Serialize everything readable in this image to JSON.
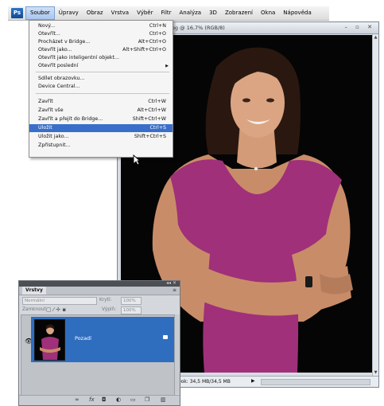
{
  "menubar": {
    "logo": "Ps",
    "items": [
      "Soubor",
      "Úpravy",
      "Obraz",
      "Vrstva",
      "Výběr",
      "Filtr",
      "Analýza",
      "3D",
      "Zobrazení",
      "Okna",
      "Nápověda"
    ],
    "active": "Soubor"
  },
  "file_menu": {
    "items": [
      {
        "label": "Nový...",
        "shortcut": "Ctrl+N"
      },
      {
        "label": "Otevřít...",
        "shortcut": "Ctrl+O"
      },
      {
        "label": "Procházet v Bridge...",
        "shortcut": "Alt+Ctrl+O"
      },
      {
        "label": "Otevřít jako...",
        "shortcut": "Alt+Shift+Ctrl+O"
      },
      {
        "label": "Otevřít jako inteligentní objekt...",
        "shortcut": ""
      },
      {
        "label": "Otevřít poslední",
        "shortcut": "",
        "submenu": true
      },
      {
        "label": "Sdílet obrazovku...",
        "shortcut": ""
      },
      {
        "label": "Device Central...",
        "shortcut": ""
      },
      {
        "label": "Zavřít",
        "shortcut": "Ctrl+W"
      },
      {
        "label": "Zavřít vše",
        "shortcut": "Alt+Ctrl+W"
      },
      {
        "label": "Zavřít a přejít do Bridge...",
        "shortcut": "Shift+Ctrl+W"
      },
      {
        "label": "Uložit",
        "shortcut": "Ctrl+S",
        "highlighted": true
      },
      {
        "label": "Uložit jako...",
        "shortcut": "Shift+Ctrl+S"
      },
      {
        "label": "Zpřístupnit...",
        "shortcut": ""
      }
    ]
  },
  "document": {
    "title": "jpg @ 16,7% (RGB/8)",
    "window_buttons": "– ▫ ✕",
    "status": "Dok: 34,5 MB/34,5 MB",
    "status_arrow": "▶"
  },
  "layers_panel": {
    "tab": "Vrstvy",
    "blend_mode": "Normální",
    "opacity_label": "Krytí:",
    "opacity_value": "100%",
    "lock_label": "Zamknout:",
    "fill_label": "Výplň:",
    "fill_value": "100%",
    "layer_name": "Pozadí",
    "bottom_icons": [
      "link-icon",
      "fx-icon",
      "mask-icon",
      "adjustment-icon",
      "folder-icon",
      "new-layer-icon",
      "trash-icon"
    ]
  },
  "colors": {
    "menu_highlight": "#3a6fc9",
    "layer_selected": "#2f6dbf",
    "shirt": "#a0307a"
  }
}
